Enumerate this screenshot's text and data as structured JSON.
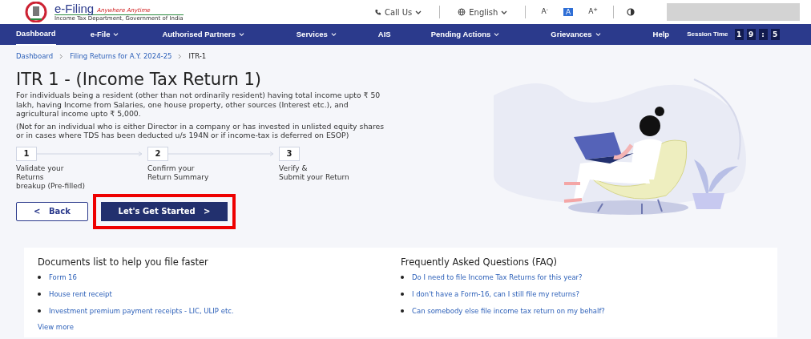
{
  "header": {
    "brand": "e-Filing",
    "tagline": "Anywhere Anytime",
    "subtitle": "Income Tax Department, Government of India",
    "call_us": "Call Us",
    "language": "English",
    "font_sizes": [
      {
        "label": "A",
        "sup": "-",
        "selected": false
      },
      {
        "label": "A",
        "selected": true
      },
      {
        "label": "A",
        "sup": "+",
        "selected": false
      }
    ]
  },
  "nav": {
    "items": [
      {
        "label": "Dashboard",
        "has_menu": false,
        "selected": true
      },
      {
        "label": "e-File",
        "has_menu": true,
        "selected": false
      },
      {
        "label": "Authorised Partners",
        "has_menu": true,
        "selected": false
      },
      {
        "label": "Services",
        "has_menu": true,
        "selected": false
      },
      {
        "label": "AIS",
        "has_menu": false,
        "selected": false
      },
      {
        "label": "Pending Actions",
        "has_menu": true,
        "selected": false
      },
      {
        "label": "Grievances",
        "has_menu": true,
        "selected": false
      },
      {
        "label": "Help",
        "has_menu": false,
        "selected": false
      }
    ],
    "session_label": "Session Time",
    "session_digits": [
      "1",
      "9",
      ":",
      "5"
    ]
  },
  "breadcrumb": [
    {
      "label": "Dashboard",
      "current": false
    },
    {
      "label": "Filing Returns for A.Y. 2024-25",
      "current": false
    },
    {
      "label": "ITR-1",
      "current": true
    }
  ],
  "title": "ITR 1 - (Income Tax Return 1)",
  "description": "For individuals being a resident (other than not ordinarily resident) having total income upto ₹ 50 lakh, having Income from Salaries, one house property, other sources (Interest etc.), and agricultural income upto ₹ 5,000.",
  "note": "(Not for an individual who is either Director in a company or has invested in unlisted equity shares or in cases where TDS has been deducted u/s 194N or if income-tax is deferred on ESOP)",
  "steps": [
    {
      "number": "1",
      "lines": [
        "Validate your",
        "Returns",
        "breakup (Pre-filled)"
      ]
    },
    {
      "number": "2",
      "lines": [
        "Confirm your",
        "Return Summary"
      ]
    },
    {
      "number": "3",
      "lines": [
        "Verify &",
        "Submit your Return"
      ]
    }
  ],
  "buttons": [
    {
      "kind": "back",
      "label": "Back",
      "arrow": "<",
      "highlighted": false
    },
    {
      "kind": "primary",
      "label": "Let's Get Started",
      "arrow": ">",
      "highlighted": true
    }
  ],
  "documents": {
    "title": "Documents list to help you file faster",
    "items": [
      "Form 16",
      "House rent receipt",
      "Investment premium payment receipts - LIC, ULIP etc."
    ],
    "more": "View more"
  },
  "faq": {
    "title": "Frequently Asked Questions (FAQ)",
    "items": [
      "Do I need to file Income Tax Returns for this year?",
      "I don't have a Form-16, can I still file my returns?",
      "Can somebody else file income tax return on my behalf?"
    ]
  }
}
